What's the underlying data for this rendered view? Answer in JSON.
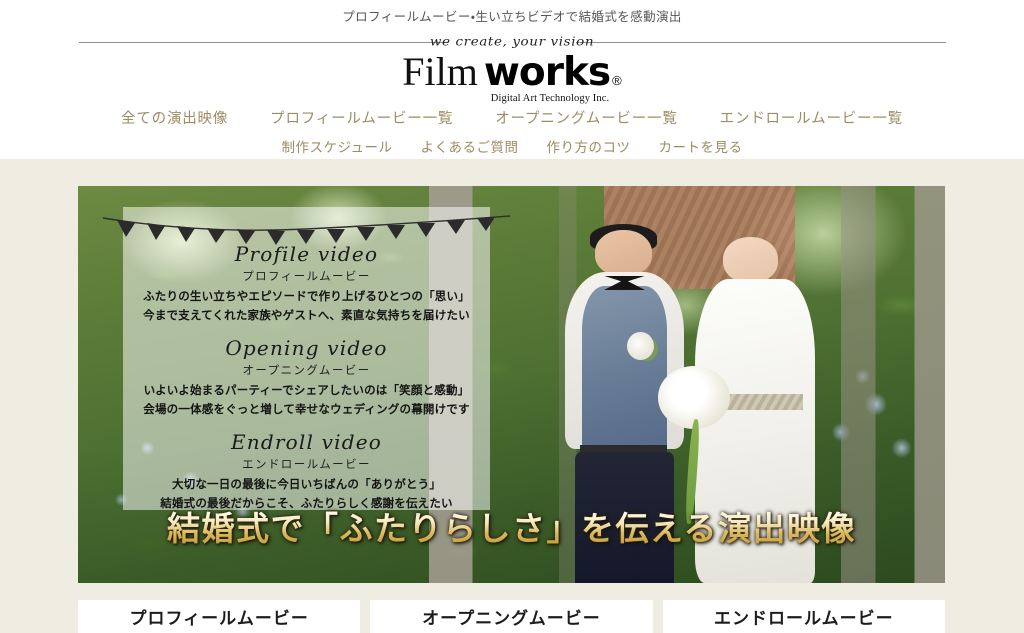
{
  "header": {
    "tagline": "プロフィールムービー・生い立ちビデオで結婚式を感動演出",
    "logo": {
      "script_tagline": "we create, your vision",
      "name_light": "Film",
      "name_bold": "works",
      "registered_mark": "®",
      "subtitle": "Digital Art Technology Inc."
    }
  },
  "nav": {
    "row1": [
      {
        "label": "全ての演出映像"
      },
      {
        "label": "プロフィールムービー一覧"
      },
      {
        "label": "オープニングムービー一覧"
      },
      {
        "label": "エンドロールムービー一覧"
      }
    ],
    "row2": [
      {
        "label": "制作スケジュール"
      },
      {
        "label": "よくあるご質問"
      },
      {
        "label": "作り方のコツ"
      },
      {
        "label": "カートを見る"
      }
    ]
  },
  "hero": {
    "headline": "結婚式で「ふたりらしさ」を伝える演出映像",
    "sections": [
      {
        "script": "Profile video",
        "jp": "プロフィールムービー",
        "desc_line1": "ふたりの生い立ちやエピソードで作り上げるひとつの「思い」",
        "desc_line2": "今まで支えてくれた家族やゲストへ、素直な気持ちを届けたい"
      },
      {
        "script": "Opening video",
        "jp": "オープニングムービー",
        "desc_line1": "いよいよ始まるパーティーでシェアしたいのは「笑顔と感動」",
        "desc_line2": "会場の一体感をぐっと増して幸せなウェディングの幕開けです"
      },
      {
        "script": "Endroll video",
        "jp": "エンドロールムービー",
        "desc_line1": "大切な一日の最後に今日いちばんの「ありがとう」",
        "desc_line2": "結婚式の最後だからこそ、ふたりらしく感謝を伝えたい"
      }
    ]
  },
  "cards": [
    {
      "title": "プロフィールムービー"
    },
    {
      "title": "オープニングムービー"
    },
    {
      "title": "エンドロールムービー"
    }
  ],
  "colors": {
    "page_background": "#efece2",
    "header_background": "#ffffff",
    "nav_link": "#9d8c63",
    "headline_gold": "#d9b85a",
    "card_background": "#ffffff",
    "rule": "#8e8e90"
  }
}
